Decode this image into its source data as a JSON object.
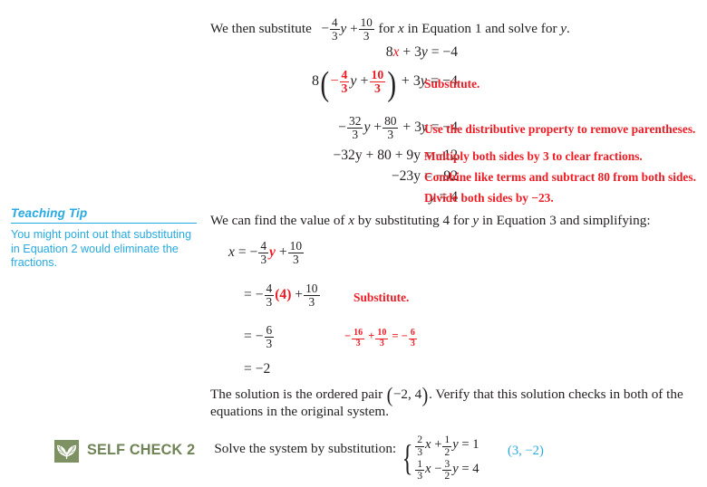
{
  "page": {
    "background": "#ffffff",
    "text_color": "#231f20",
    "accent_red": "#ed1c24",
    "accent_blue": "#27aae1",
    "accent_green": "#6f8356",
    "badge_green": "#7d9162"
  },
  "intro": {
    "before": "We then substitute",
    "frac1_num": "4",
    "frac1_den": "3",
    "var_y": "y",
    "plus": "+",
    "frac2_num": "10",
    "frac2_den": "3",
    "middle": "for",
    "var_x": "x",
    "after": "in Equation 1 and solve for",
    "var_y2": "y",
    "period": "."
  },
  "steps": [
    {
      "id": "eq-1",
      "equation_text": "8x + 3y = -4",
      "annotation": ""
    },
    {
      "id": "eq-2",
      "equation_text": "8(-4/3 y + 10/3) + 3y = -4",
      "annotation": "Substitute."
    },
    {
      "id": "eq-3",
      "equation_text": "-32/3 y + 80/3 + 3y = -4",
      "annotation": "Use the distributive property to remove parentheses."
    },
    {
      "id": "eq-4",
      "equation_text": "-32y + 80 + 9y = -12",
      "annotation": "Multiply both sides by 3 to clear fractions."
    },
    {
      "id": "eq-5",
      "equation_text": "-23y = -92",
      "annotation": "Combine like terms and subtract 80 from both sides."
    },
    {
      "id": "eq-6",
      "equation_text": "y = 4",
      "annotation": "Divide both sides by -23."
    }
  ],
  "eq1": {
    "coef8": "8",
    "x": "x",
    "plus": "+",
    "three": "3",
    "y": "y",
    "equals": "=",
    "rhs": "−4"
  },
  "eq2": {
    "coef8": "8",
    "minus": "−",
    "num1": "4",
    "den1": "3",
    "y1": "y",
    "plus1": "+",
    "num2": "10",
    "den2": "3",
    "plus2": "+",
    "three": "3",
    "y2": "y",
    "equals": "=",
    "rhs": "−4",
    "annotation": "Substitute."
  },
  "eq3": {
    "minus": "−",
    "num1": "32",
    "den1": "3",
    "y1": "y",
    "plus1": "+",
    "num2": "80",
    "den2": "3",
    "plus2": "+",
    "three": "3",
    "y2": "y",
    "equals": "=",
    "rhs": "−4",
    "annotation": "Use the distributive property to remove parentheses."
  },
  "eq4": {
    "lhs": "−32y + 80 + 9y",
    "equals": "=",
    "rhs": "−12",
    "annotation": "Multiply both sides by 3 to clear fractions."
  },
  "eq5": {
    "lhs": "−23y",
    "equals": "=",
    "rhs": "−92",
    "annotation": "Combine like terms and subtract 80 from both sides."
  },
  "eq6": {
    "lhs": "y",
    "equals": "=",
    "rhs": "4",
    "annotation": "Divide both sides by −23."
  },
  "teaching_tip": {
    "title": "Teaching Tip",
    "body": "You might point out that substituting in Equation 2 would eliminate the fractions."
  },
  "midtext": {
    "part1": "We can find the value of",
    "var_x": "x",
    "part2": "by substituting 4 for",
    "var_y": "y",
    "part3": "in Equation 3 and simplifying:"
  },
  "xsteps": {
    "line1": {
      "lhs": "x",
      "equals": "=",
      "minus": "−",
      "num": "4",
      "den": "3",
      "y": "y",
      "plus": "+",
      "num2": "10",
      "den2": "3"
    },
    "line2": {
      "equals": "=",
      "minus": "−",
      "num": "4",
      "den": "3",
      "sub": "(4)",
      "plus": "+",
      "num2": "10",
      "den2": "3",
      "annotation": "Substitute."
    },
    "line3": {
      "equals": "=",
      "minus": "−",
      "num": "6",
      "den": "3",
      "annot_minus": "−",
      "annot_n1": "16",
      "annot_d1": "3",
      "annot_plus": "+",
      "annot_n2": "10",
      "annot_d2": "3",
      "annot_eq": "=",
      "annot_minus2": "−",
      "annot_n3": "6",
      "annot_d3": "3"
    },
    "line4": {
      "equals": "=",
      "value": "−2"
    }
  },
  "conclusion": {
    "before": "The solution is the ordered pair",
    "pair_open": "(",
    "pair": "−2, 4",
    "pair_close": ")",
    "after": ". Verify that this solution checks in both of the equations in the original system."
  },
  "self_check": {
    "icon": "leaf-icon",
    "label": "SELF CHECK 2",
    "prompt": "Solve the system by substitution:",
    "system": {
      "row1": {
        "num1": "2",
        "den1": "3",
        "x": "x",
        "plus": "+",
        "num2": "1",
        "den2": "2",
        "y": "y",
        "equals": "=",
        "rhs": "1"
      },
      "row2": {
        "num1": "1",
        "den1": "3",
        "x": "x",
        "minus": "−",
        "num2": "3",
        "den2": "2",
        "y": "y",
        "equals": "=",
        "rhs": "4"
      }
    },
    "answer": "(3, −2)"
  }
}
